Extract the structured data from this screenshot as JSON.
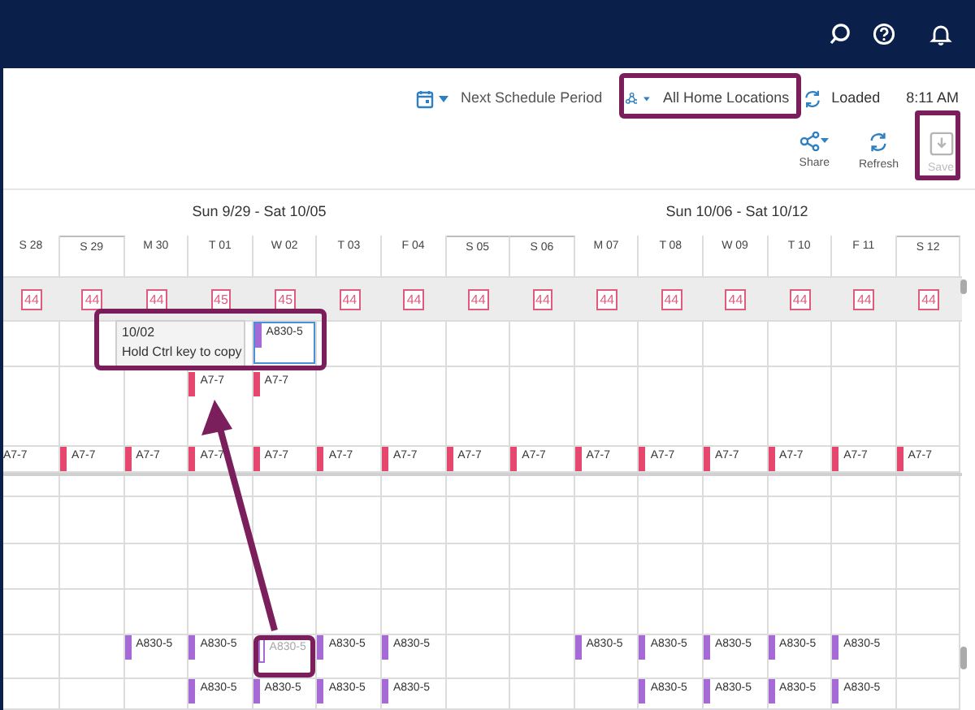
{
  "toolbar": {
    "period": "Next Schedule Period",
    "location": "All Home Locations",
    "status": "Loaded",
    "time": "8:11 AM"
  },
  "actions": [
    {
      "label": "Share",
      "kind": "share",
      "disabled": false
    },
    {
      "label": "Refresh",
      "kind": "refresh",
      "disabled": false
    },
    {
      "label": "Save",
      "kind": "save",
      "disabled": true
    }
  ],
  "weeks": [
    "Sun 9/29 - Sat 10/05",
    "Sun 10/06 - Sat 10/12"
  ],
  "days": [
    {
      "label": "S 28",
      "weekend": false
    },
    {
      "label": "S 29",
      "weekend": true
    },
    {
      "label": "M 30",
      "weekend": false
    },
    {
      "label": "T 01",
      "weekend": false
    },
    {
      "label": "W 02",
      "weekend": false
    },
    {
      "label": "T 03",
      "weekend": false
    },
    {
      "label": "F 04",
      "weekend": false
    },
    {
      "label": "S 05",
      "weekend": true
    },
    {
      "label": "S 06",
      "weekend": true
    },
    {
      "label": "M 07",
      "weekend": false
    },
    {
      "label": "T 08",
      "weekend": false
    },
    {
      "label": "W 09",
      "weekend": false
    },
    {
      "label": "T 10",
      "weekend": false
    },
    {
      "label": "F 11",
      "weekend": false
    },
    {
      "label": "S 12",
      "weekend": true
    }
  ],
  "counts": [
    "44",
    "44",
    "44",
    "45",
    "45",
    "44",
    "44",
    "44",
    "44",
    "44",
    "44",
    "44",
    "44",
    "44",
    "44"
  ],
  "tooltip": {
    "date": "10/02",
    "hint": "Hold Ctrl key to copy"
  },
  "rows": [
    {
      "cells": [
        {},
        {},
        {},
        {},
        {
          "code": "A830-5",
          "color": "#a56ad6",
          "dragging": true
        },
        {},
        {},
        {},
        {},
        {},
        {},
        {},
        {},
        {},
        {}
      ]
    },
    {
      "cells": [
        {},
        {},
        {},
        {
          "code": "A7-7",
          "color": "#e5476f"
        },
        {
          "code": "A7-7",
          "color": "#e5476f"
        },
        {},
        {},
        {},
        {},
        {},
        {},
        {},
        {},
        {},
        {}
      ]
    },
    {
      "cells": [
        {
          "code": "A7-7"
        },
        {
          "code": "A7-7",
          "color": "#e5476f"
        },
        {
          "code": "A7-7",
          "color": "#e5476f"
        },
        {
          "code": "A7-7",
          "color": "#e5476f"
        },
        {
          "code": "A7-7",
          "color": "#e5476f"
        },
        {
          "code": "A7-7",
          "color": "#e5476f"
        },
        {
          "code": "A7-7",
          "color": "#e5476f"
        },
        {
          "code": "A7-7",
          "color": "#e5476f"
        },
        {
          "code": "A7-7",
          "color": "#e5476f"
        },
        {
          "code": "A7-7",
          "color": "#e5476f"
        },
        {
          "code": "A7-7",
          "color": "#e5476f"
        },
        {
          "code": "A7-7",
          "color": "#e5476f"
        },
        {
          "code": "A7-7",
          "color": "#e5476f"
        },
        {
          "code": "A7-7",
          "color": "#e5476f"
        },
        {
          "code": "A7-7",
          "color": "#e5476f"
        }
      ]
    },
    {
      "cells": [
        {},
        {},
        {},
        {},
        {},
        {},
        {},
        {},
        {},
        {},
        {},
        {},
        {},
        {},
        {}
      ]
    },
    {
      "cells": [
        {},
        {},
        {},
        {},
        {},
        {},
        {},
        {},
        {},
        {},
        {},
        {},
        {},
        {},
        {}
      ]
    },
    {
      "cells": [
        {},
        {},
        {},
        {},
        {},
        {},
        {},
        {},
        {},
        {},
        {},
        {},
        {},
        {},
        {}
      ]
    },
    {
      "cells": [
        {},
        {},
        {},
        {},
        {},
        {},
        {},
        {},
        {},
        {},
        {},
        {},
        {},
        {},
        {}
      ]
    },
    {
      "cells": [
        {},
        {},
        {
          "code": "A830-5",
          "color": "#a56ad6"
        },
        {
          "code": "A830-5",
          "color": "#a56ad6"
        },
        {
          "code": "A830-5",
          "color": "#a56ad6",
          "ghost": true
        },
        {
          "code": "A830-5",
          "color": "#a56ad6"
        },
        {
          "code": "A830-5",
          "color": "#a56ad6"
        },
        {},
        {},
        {
          "code": "A830-5",
          "color": "#a56ad6"
        },
        {
          "code": "A830-5",
          "color": "#a56ad6"
        },
        {
          "code": "A830-5",
          "color": "#a56ad6"
        },
        {
          "code": "A830-5",
          "color": "#a56ad6"
        },
        {
          "code": "A830-5",
          "color": "#a56ad6"
        },
        {}
      ]
    },
    {
      "cells": [
        {},
        {},
        {},
        {
          "code": "A830-5",
          "color": "#a56ad6"
        },
        {
          "code": "A830-5",
          "color": "#a56ad6"
        },
        {
          "code": "A830-5",
          "color": "#a56ad6"
        },
        {
          "code": "A830-5",
          "color": "#a56ad6"
        },
        {},
        {},
        {},
        {
          "code": "A830-5",
          "color": "#a56ad6"
        },
        {
          "code": "A830-5",
          "color": "#a56ad6"
        },
        {
          "code": "A830-5",
          "color": "#a56ad6"
        },
        {
          "code": "A830-5",
          "color": "#a56ad6"
        },
        {}
      ]
    }
  ]
}
